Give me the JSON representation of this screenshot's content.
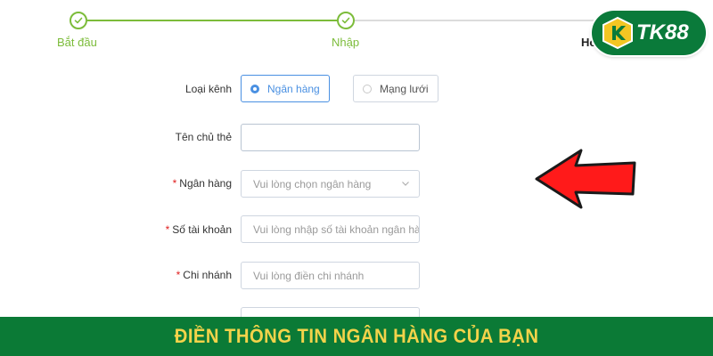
{
  "stepper": {
    "steps": [
      {
        "label": "Bắt đầu",
        "status": "done"
      },
      {
        "label": "Nhập",
        "status": "done"
      },
      {
        "label": "Ho",
        "status": "current"
      }
    ]
  },
  "logo": {
    "text": "TK88"
  },
  "form": {
    "channel_type": {
      "label": "Loại kênh",
      "options": [
        {
          "label": "Ngân hàng",
          "selected": true
        },
        {
          "label": "Mạng lưới",
          "selected": false
        }
      ]
    },
    "holder_name": {
      "label": "Tên chủ thẻ",
      "value": ""
    },
    "bank": {
      "required_mark": "*",
      "label": "Ngân hàng",
      "placeholder": "Vui lòng chọn ngân hàng"
    },
    "account_number": {
      "required_mark": "*",
      "label": "Số tài khoản",
      "placeholder": "Vui lòng nhập số tài khoản ngân hà"
    },
    "branch": {
      "required_mark": "*",
      "label": "Chi nhánh",
      "placeholder": "Vui lòng điền chi nhánh"
    }
  },
  "banner": {
    "text": "ĐIỀN THÔNG TIN NGÂN HÀNG CỦA BẠN"
  },
  "colors": {
    "accent_green": "#7cbc3a",
    "brand_green": "#0b7a36",
    "banner_text": "#f3d34a",
    "selected_blue": "#4a90e2",
    "arrow_red": "#ff1a1a"
  }
}
